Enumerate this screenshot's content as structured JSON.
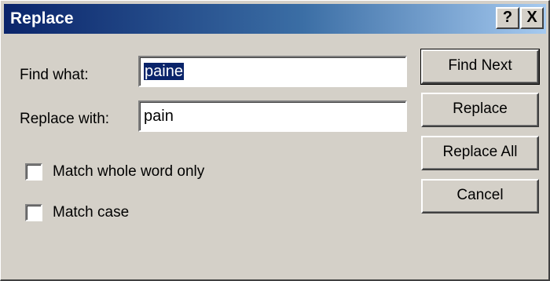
{
  "window": {
    "title": "Replace"
  },
  "titlebar_buttons": {
    "help": "?",
    "close": "X"
  },
  "find": {
    "label": "Find what:",
    "value": "paine",
    "selected": true
  },
  "replace": {
    "label": "Replace with:",
    "value": "pain"
  },
  "options": {
    "match_whole_word": {
      "label": "Match whole word only",
      "checked": false
    },
    "match_case": {
      "label": "Match case",
      "checked": false
    }
  },
  "buttons": {
    "find_next": "Find Next",
    "replace": "Replace",
    "replace_all": "Replace All",
    "cancel": "Cancel"
  },
  "colors": {
    "titlebar_start": "#0a246a",
    "titlebar_end": "#a6caf0",
    "face": "#d4d0c8",
    "selection": "#0a246a"
  }
}
